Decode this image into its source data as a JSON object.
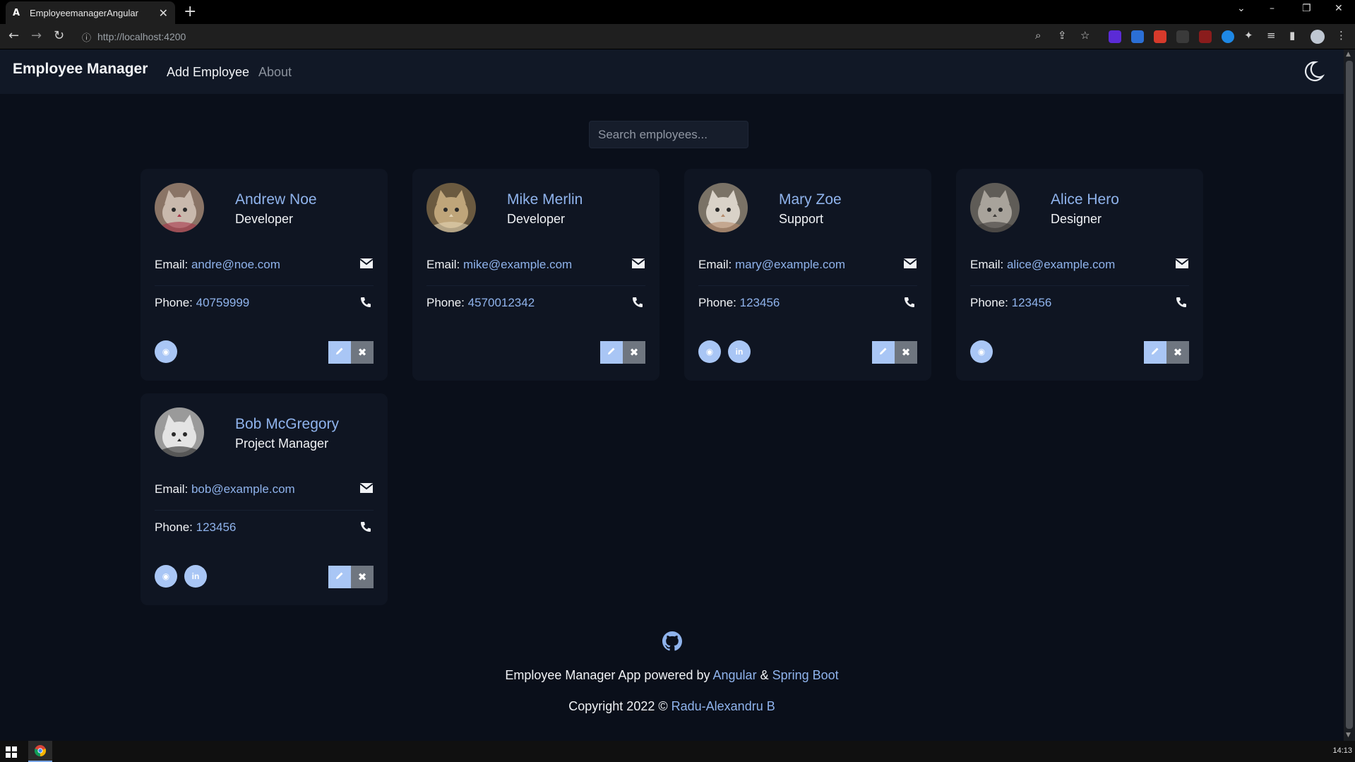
{
  "browser": {
    "tab_title": "EmployeemanagerAngular",
    "tab_favicon": "A",
    "url": "http://localhost:4200",
    "window_controls": [
      "⌄",
      "–",
      "❐",
      "✕"
    ]
  },
  "app": {
    "brand": "Employee Manager",
    "nav": {
      "add_employee": "Add Employee",
      "about": "About"
    },
    "theme_toggle_icon": "moon-icon"
  },
  "search": {
    "placeholder": "Search employees..."
  },
  "labels": {
    "email": "Email:",
    "phone": "Phone:"
  },
  "employees": [
    {
      "name": "Andrew Noe",
      "job": "Developer",
      "email": "andre@noe.com",
      "phone": "40759999",
      "socials": [
        "website"
      ],
      "avatar_colors": [
        "#8a7466",
        "#c9b9ad",
        "#a8354a"
      ]
    },
    {
      "name": "Mike Merlin",
      "job": "Developer",
      "email": "mike@example.com",
      "phone": "4570012342",
      "socials": [],
      "avatar_colors": [
        "#6b5a40",
        "#bfa57a",
        "#e2d3b4"
      ]
    },
    {
      "name": "Mary Zoe",
      "job": "Support",
      "email": "mary@example.com",
      "phone": "123456",
      "socials": [
        "website",
        "linkedin"
      ],
      "avatar_colors": [
        "#7a7266",
        "#d9d2c8",
        "#b58a6a"
      ]
    },
    {
      "name": "Alice Hero",
      "job": "Designer",
      "email": "alice@example.com",
      "phone": "123456",
      "socials": [
        "website"
      ],
      "avatar_colors": [
        "#5f5c57",
        "#a8a39b",
        "#3d3b38"
      ]
    },
    {
      "name": "Bob McGregory",
      "job": "Project Manager",
      "email": "bob@example.com",
      "phone": "123456",
      "socials": [
        "website",
        "linkedin"
      ],
      "avatar_colors": [
        "#9a9a9a",
        "#e4e4e4",
        "#2c2c2c"
      ]
    }
  ],
  "social_glyphs": {
    "website": "◉",
    "linkedin": "in"
  },
  "footer": {
    "powered_prefix": "Employee Manager App powered by",
    "angular": "Angular",
    "amp": "&",
    "spring": "Spring Boot",
    "copyright_prefix": "Copyright 2022 ©",
    "author": "Radu-Alexandru B"
  },
  "taskbar": {
    "clock": "14:13"
  },
  "colors": {
    "accent": "#8fb3ec",
    "button_light": "#a9c6f5",
    "button_gray": "#6f7680",
    "background": "#0a0f1a",
    "card": "#0f1522"
  }
}
